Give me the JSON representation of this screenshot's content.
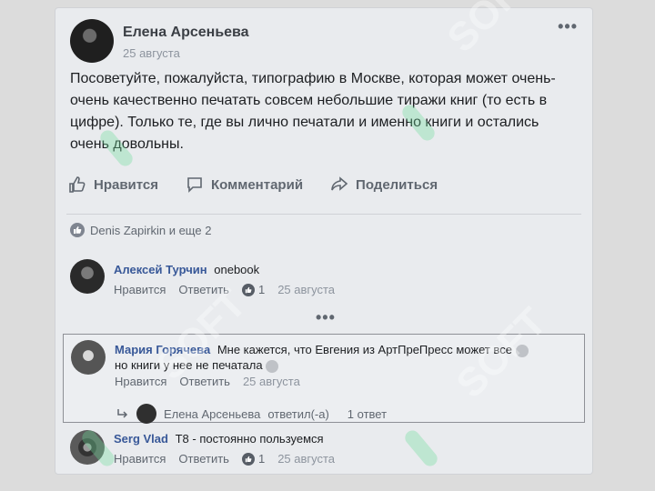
{
  "post": {
    "author": "Елена Арсеньева",
    "date": "25 августа",
    "more": "•••",
    "text": "Посоветуйте, пожалуйста, типографию в Москве, которая может очень-очень качественно печатать совсем небольшие тиражи книг (то есть в цифре). Только те, где вы лично печатали и именно книги и остались очень довольны."
  },
  "actions": {
    "like": "Нравится",
    "comment": "Комментарий",
    "share": "Поделиться"
  },
  "reactions": {
    "text": "Denis Zapirkin и еще 2"
  },
  "comments": [
    {
      "name": "Алексей Турчин",
      "text": "onebook",
      "like": "Нравится",
      "reply": "Ответить",
      "likes": "1",
      "date": "25 августа"
    },
    {
      "name": "Мария Горячева",
      "text": "Мне кажется, что Евгения из АртПреПресс может все",
      "text2": "но книги у нее не печатала",
      "like": "Нравится",
      "reply": "Ответить",
      "date": "25 августа",
      "replies": {
        "author": "Елена Арсеньева",
        "action": "ответил(-а)",
        "count": "1 ответ"
      }
    },
    {
      "name": "Serg Vlad",
      "text": "Т8 - постоянно пользуемся",
      "like": "Нравится",
      "reply": "Ответить",
      "likes": "1",
      "date": "25 августа"
    }
  ],
  "more_comments": "•••",
  "watermark": "SOFT"
}
